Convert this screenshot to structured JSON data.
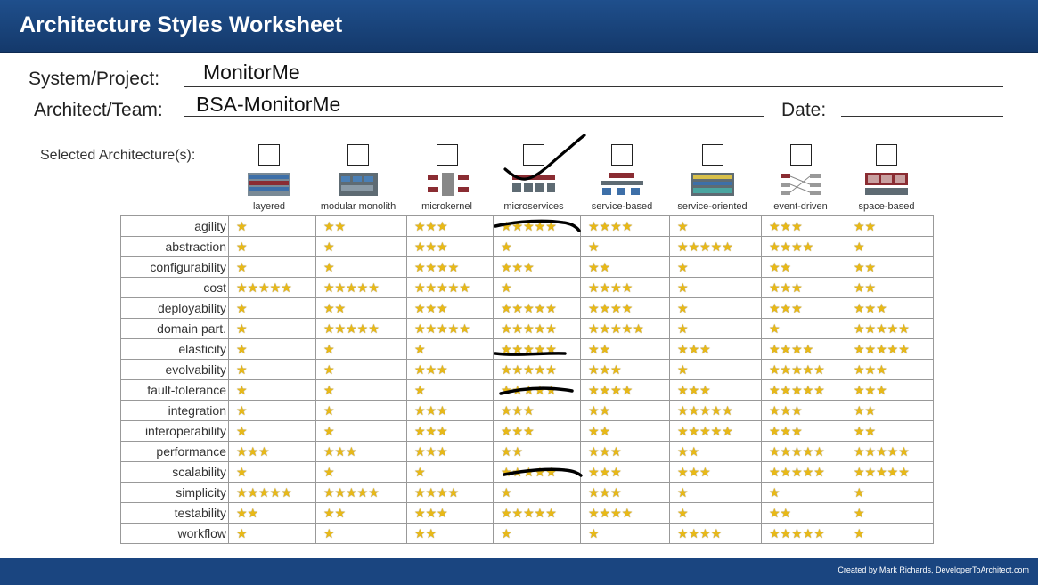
{
  "header": {
    "title": "Architecture Styles Worksheet"
  },
  "form": {
    "system_label": "System/Project:",
    "system_value": "MonitorMe",
    "architect_label": "Architect/Team:",
    "architect_value": "BSA-MonitorMe",
    "date_label": "Date:",
    "date_value": ""
  },
  "selected_label": "Selected Architecture(s):",
  "architectures": [
    {
      "name": "layered",
      "checked": false
    },
    {
      "name": "modular monolith",
      "checked": false
    },
    {
      "name": "microkernel",
      "checked": false
    },
    {
      "name": "microservices",
      "checked": true
    },
    {
      "name": "service-based",
      "checked": false
    },
    {
      "name": "service-oriented",
      "checked": false
    },
    {
      "name": "event-driven",
      "checked": false
    },
    {
      "name": "space-based",
      "checked": false
    }
  ],
  "ratings": [
    {
      "attribute": "agility",
      "stars": [
        1,
        2,
        3,
        5,
        4,
        1,
        3,
        2
      ]
    },
    {
      "attribute": "abstraction",
      "stars": [
        1,
        1,
        3,
        1,
        1,
        5,
        4,
        1
      ]
    },
    {
      "attribute": "configurability",
      "stars": [
        1,
        1,
        4,
        3,
        2,
        1,
        2,
        2
      ]
    },
    {
      "attribute": "cost",
      "stars": [
        5,
        5,
        5,
        1,
        4,
        1,
        3,
        2
      ]
    },
    {
      "attribute": "deployability",
      "stars": [
        1,
        2,
        3,
        5,
        4,
        1,
        3,
        3
      ]
    },
    {
      "attribute": "domain part.",
      "stars": [
        1,
        5,
        5,
        5,
        5,
        1,
        1,
        5
      ]
    },
    {
      "attribute": "elasticity",
      "stars": [
        1,
        1,
        1,
        5,
        2,
        3,
        4,
        5
      ]
    },
    {
      "attribute": "evolvability",
      "stars": [
        1,
        1,
        3,
        5,
        3,
        1,
        5,
        3
      ]
    },
    {
      "attribute": "fault-tolerance",
      "stars": [
        1,
        1,
        1,
        5,
        4,
        3,
        5,
        3
      ]
    },
    {
      "attribute": "integration",
      "stars": [
        1,
        1,
        3,
        3,
        2,
        5,
        3,
        2
      ]
    },
    {
      "attribute": "interoperability",
      "stars": [
        1,
        1,
        3,
        3,
        2,
        5,
        3,
        2
      ]
    },
    {
      "attribute": "performance",
      "stars": [
        3,
        3,
        3,
        2,
        3,
        2,
        5,
        5
      ]
    },
    {
      "attribute": "scalability",
      "stars": [
        1,
        1,
        1,
        5,
        3,
        3,
        5,
        5
      ]
    },
    {
      "attribute": "simplicity",
      "stars": [
        5,
        5,
        4,
        1,
        3,
        1,
        1,
        1
      ]
    },
    {
      "attribute": "testability",
      "stars": [
        2,
        2,
        3,
        5,
        4,
        1,
        2,
        1
      ]
    },
    {
      "attribute": "workflow",
      "stars": [
        1,
        1,
        2,
        1,
        1,
        4,
        5,
        1
      ]
    }
  ],
  "annotations": {
    "checked_architecture": "microservices",
    "struck_attributes": [
      "agility",
      "elasticity",
      "fault-tolerance",
      "scalability"
    ]
  },
  "footer": {
    "credit": "Created by Mark Richards, DeveloperToArchitect.com"
  },
  "colors": {
    "header": "#1a4580",
    "star": "#e8b917",
    "ink": "#000000"
  }
}
